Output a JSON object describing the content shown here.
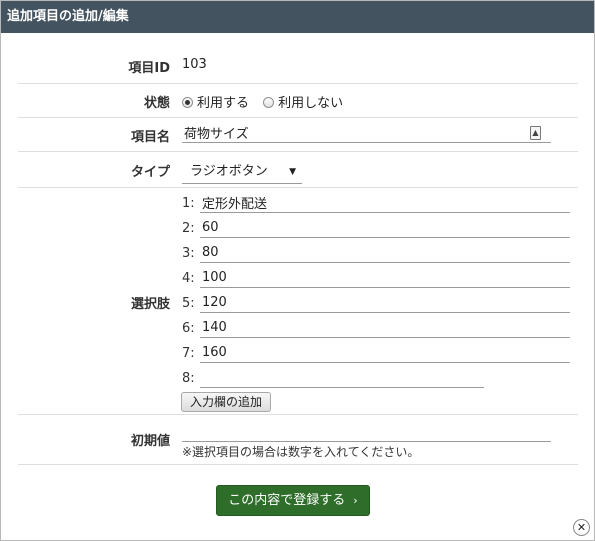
{
  "dialog": {
    "title": "追加項目の追加/編集"
  },
  "item_id": {
    "label": "項目ID",
    "value": "103"
  },
  "status": {
    "label": "状態",
    "options": [
      {
        "label": "利用する",
        "checked": true
      },
      {
        "label": "利用しない",
        "checked": false
      }
    ]
  },
  "item_name": {
    "label": "項目名",
    "value": "荷物サイズ",
    "icon": "input-assist-icon"
  },
  "type": {
    "label": "タイプ",
    "value": "ラジオボタン",
    "arrow": "▼"
  },
  "choices": {
    "label": "選択肢",
    "items": [
      {
        "num": "1:",
        "value": "定形外配送"
      },
      {
        "num": "2:",
        "value": "60"
      },
      {
        "num": "3:",
        "value": "80"
      },
      {
        "num": "4:",
        "value": "100"
      },
      {
        "num": "5:",
        "value": "120"
      },
      {
        "num": "6:",
        "value": "140"
      },
      {
        "num": "7:",
        "value": "160"
      },
      {
        "num": "8:",
        "value": ""
      }
    ],
    "add_label": "入力欄の追加"
  },
  "initial_value": {
    "label": "初期値",
    "value": "",
    "note": "※選択項目の場合は数字を入れてください。"
  },
  "submit": {
    "label": "この内容で登録する",
    "chevron": "›"
  },
  "close": {
    "glyph": "✕"
  }
}
